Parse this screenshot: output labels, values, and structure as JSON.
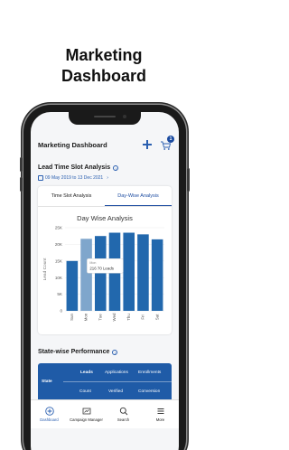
{
  "hero": {
    "line1": "Marketing",
    "line2": "Dashboard"
  },
  "colors": {
    "primary": "#1f5ba7",
    "bar": "#2268ad",
    "bar_highlight": "#7fa6cc",
    "accent_text": "#2a5fb0"
  },
  "app": {
    "title": "Marketing Dashboard",
    "cart_badge": "1"
  },
  "lead_section": {
    "title": "Lead Time Slot Analysis",
    "date_range": "09 May 2019 to 13 Dec 2021"
  },
  "tabs": [
    {
      "label": "Time Slot Analysis",
      "active": false
    },
    {
      "label": "Day-Wise Analysis",
      "active": true
    }
  ],
  "chart_data": {
    "type": "bar",
    "title": "Day Wise Analysis",
    "ylabel": "Lead Count",
    "xlabel": "",
    "categories": [
      "Sun",
      "Mon",
      "Tue",
      "Wed",
      "Thu",
      "Fri",
      "Sat"
    ],
    "values": [
      15000,
      21670,
      22500,
      23500,
      23500,
      23000,
      21500
    ],
    "highlight_index": 1,
    "ylim": [
      0,
      25000
    ],
    "yticks": [
      0,
      5000,
      10000,
      15000,
      20000,
      25000
    ],
    "ytick_labels": [
      "0",
      "5K",
      "10K",
      "15K",
      "20K",
      "25K"
    ],
    "tooltip": {
      "category": "Mon",
      "text": "216 70 Leads"
    }
  },
  "state_section": {
    "title": "State-wise Performance",
    "columns": {
      "state": "State",
      "leads": "Leads",
      "applications": "Applications",
      "enrollments": "Enrollments",
      "count": "Count",
      "verified": "Verified",
      "conversion": "Conversion"
    }
  },
  "nav": [
    {
      "label": "Dashboard",
      "icon": "plus-circle-icon",
      "active": true
    },
    {
      "label": "Campaign Manager",
      "icon": "campaign-icon",
      "active": false
    },
    {
      "label": "Search",
      "icon": "search-icon",
      "active": false
    },
    {
      "label": "More",
      "icon": "menu-icon",
      "active": false
    }
  ]
}
